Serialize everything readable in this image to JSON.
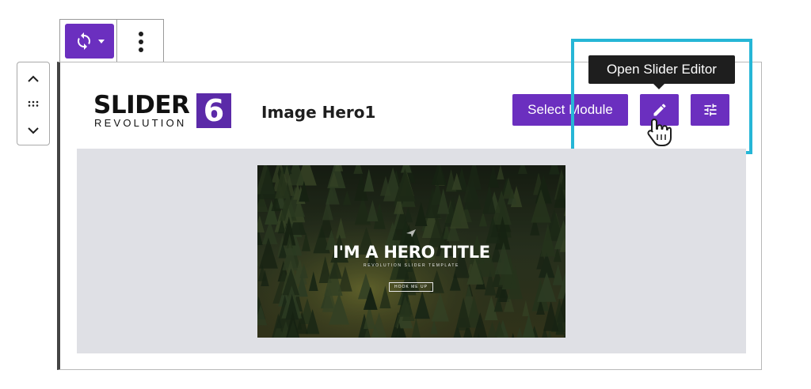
{
  "block_toolbar": {
    "transform_icon": "sync-icon",
    "transform_caret": "caret-down-icon",
    "more_icon": "vertical-ellipsis-icon"
  },
  "block_mover": {
    "up_icon": "chevron-up-icon",
    "drag_icon": "drag-handle-icon",
    "down_icon": "chevron-down-icon"
  },
  "logo": {
    "word": "SLIDER",
    "subword": "REVOLUTION",
    "version": "6"
  },
  "block": {
    "slider_name": "Image Hero1",
    "select_module_label": "Select Module",
    "edit_icon": "pencil-icon",
    "settings_icon": "sliders-icon"
  },
  "tooltip": {
    "text": "Open Slider Editor"
  },
  "preview": {
    "title": "I'M A HERO TITLE",
    "subtitle": "REVOLUTION SLIDER TEMPLATE",
    "button": "HOOK ME UP"
  },
  "colors": {
    "accent": "#6b2fbf",
    "highlight": "#26b6d6",
    "tooltip_bg": "#1e1e1e",
    "preview_bg": "#dfe0e5"
  }
}
